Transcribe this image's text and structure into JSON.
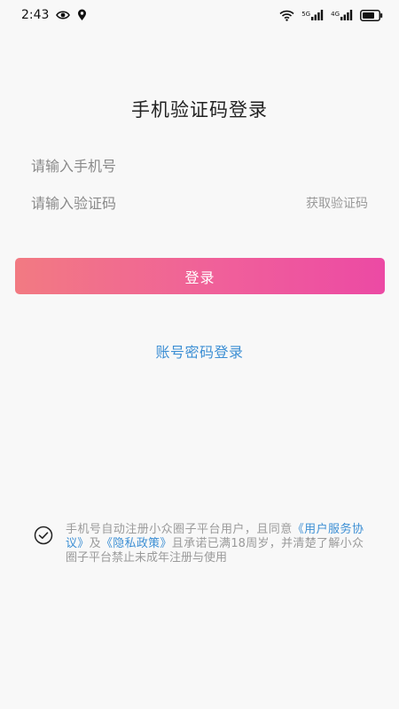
{
  "status_bar": {
    "time": "2:43",
    "left_icons": [
      "eye-icon",
      "location-pin-icon"
    ],
    "right_icons": [
      "wifi-icon",
      "signal-5g-icon",
      "signal-4g-icon",
      "battery-icon"
    ],
    "signal_tags": [
      "5G",
      "4G"
    ]
  },
  "page": {
    "title": "手机验证码登录"
  },
  "form": {
    "phone_placeholder": "请输入手机号",
    "code_placeholder": "请输入验证码",
    "get_code_label": "获取验证码",
    "login_label": "登录"
  },
  "alt_login_label": "账号密码登录",
  "agreement": {
    "text_1": "手机号自动注册小众圈子平台用户，且同意",
    "link_user": "《用户服务协议》",
    "text_2": "及",
    "link_privacy": "《隐私政策》",
    "text_3": "且承诺已满18周岁，并清楚了解小众圈子平台禁止未成年注册与使用"
  },
  "colors": {
    "accent_start": "#f27a82",
    "accent_end": "#ec4aa4",
    "link": "#3d8fd4"
  }
}
